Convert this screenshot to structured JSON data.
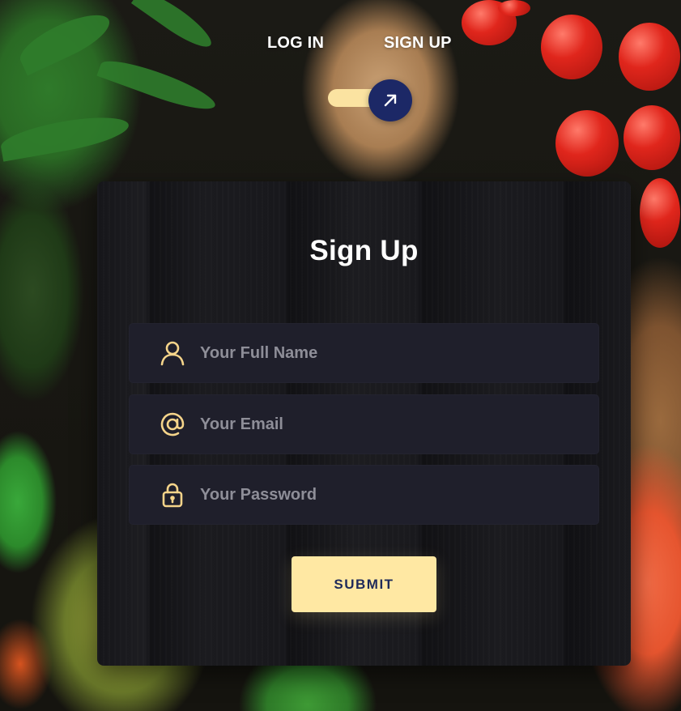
{
  "nav": {
    "login_label": "LOG IN",
    "signup_label": "SIGN UP",
    "toggle_icon": "arrow-up-right-icon"
  },
  "form": {
    "title": "Sign Up",
    "fields": [
      {
        "placeholder": "Your Full Name",
        "value": "",
        "icon": "user-icon"
      },
      {
        "placeholder": "Your Email",
        "value": "",
        "icon": "at-sign-icon"
      },
      {
        "placeholder": "Your Password",
        "value": "",
        "icon": "lock-icon"
      }
    ],
    "submit_label": "SUBMIT"
  },
  "colors": {
    "accent": "#ffe8a3",
    "knob": "#1c2866",
    "field_bg": "#1f1f2b",
    "button_text": "#1e2a5a",
    "icon": "#f5d48a"
  }
}
